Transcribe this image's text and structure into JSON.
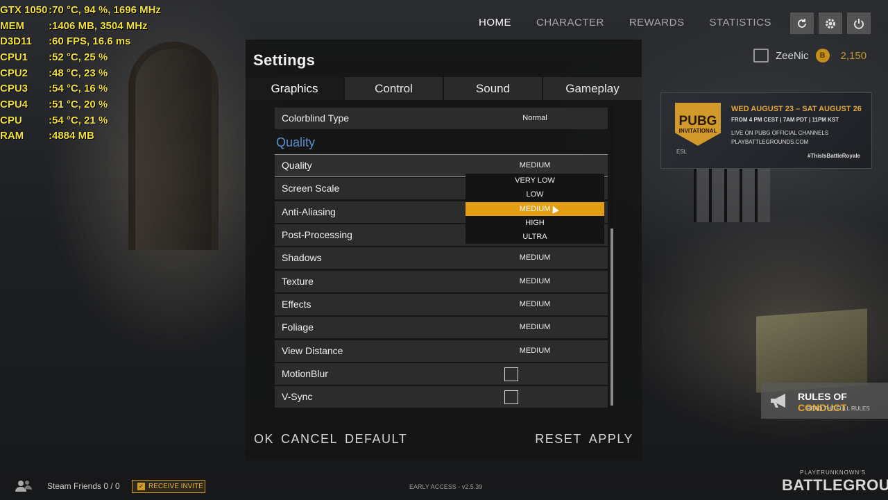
{
  "overlay": {
    "rows": [
      {
        "label": "GTX 1050",
        "value": ":70 °C, 94 %, 1696 MHz"
      },
      {
        "label": "MEM",
        "value": ":1406 MB, 3504 MHz"
      },
      {
        "label": "D3D11",
        "value": ":60 FPS, 16.6 ms"
      },
      {
        "label": "CPU1",
        "value": ":52 °C, 25 %"
      },
      {
        "label": "CPU2",
        "value": ":48 °C, 23 %"
      },
      {
        "label": "CPU3",
        "value": ":54 °C, 16 %"
      },
      {
        "label": "CPU4",
        "value": ":51 °C, 20 %"
      },
      {
        "label": "CPU",
        "value": ":54 °C, 21 %"
      },
      {
        "label": "RAM",
        "value": ":4884 MB"
      }
    ]
  },
  "topnav": {
    "items": [
      "HOME",
      "CHARACTER",
      "REWARDS",
      "STATISTICS"
    ],
    "active": "HOME",
    "icons": [
      "refresh-icon",
      "gear-icon",
      "power-icon"
    ]
  },
  "user": {
    "name": "ZeeNic",
    "currency": "2,150",
    "accent": "#c5952a"
  },
  "banner": {
    "logo_line1": "PUBG",
    "logo_line2": "INVITATIONAL",
    "dates": "WED AUGUST 23 – SAT AUGUST 26",
    "times": "FROM 4 PM CEST | 7AM PDT | 11PM KST",
    "live": "LIVE ON PUBG OFFICIAL CHANNELS",
    "url": "PLAYBATTLEGROUNDS.COM",
    "tag": "#ThisIsBattleRoyale",
    "sponsor": "ESL"
  },
  "rules": {
    "title_part1": "RULES OF ",
    "title_part2": "CONDUCT",
    "subtitle": "READ THE FULL RULES"
  },
  "bottom": {
    "friends": "Steam Friends 0 / 0",
    "invite": "RECEIVE INVITE",
    "version": "EARLY ACCESS - v2.5.39",
    "brand_small": "PLAYERUNKNOWN'S",
    "brand_big": "BATTLEGROUNDS"
  },
  "settings": {
    "title": "Settings",
    "tabs": [
      "Graphics",
      "Control",
      "Sound",
      "Gameplay"
    ],
    "active_tab": "Graphics",
    "colorblind": {
      "label": "Colorblind Type",
      "value": "Normal"
    },
    "section": "Quality",
    "rows": [
      {
        "label": "Quality",
        "value": "MEDIUM"
      },
      {
        "label": "Screen Scale",
        "value": ""
      },
      {
        "label": "Anti-Aliasing",
        "value": ""
      },
      {
        "label": "Post-Processing",
        "value": ""
      },
      {
        "label": "Shadows",
        "value": "MEDIUM"
      },
      {
        "label": "Texture",
        "value": "MEDIUM"
      },
      {
        "label": "Effects",
        "value": "MEDIUM"
      },
      {
        "label": "Foliage",
        "value": "MEDIUM"
      },
      {
        "label": "View Distance",
        "value": "MEDIUM"
      }
    ],
    "checkbox_rows": [
      {
        "label": "MotionBlur",
        "checked": false
      },
      {
        "label": "V-Sync",
        "checked": false
      }
    ],
    "dropdown": {
      "options": [
        "VERY LOW",
        "LOW",
        "MEDIUM",
        "HIGH",
        "ULTRA"
      ],
      "selected": "MEDIUM",
      "highlight_color": "#e39d12"
    },
    "footer_left": [
      "OK",
      "CANCEL",
      "DEFAULT"
    ],
    "footer_right": [
      "RESET",
      "APPLY"
    ]
  }
}
